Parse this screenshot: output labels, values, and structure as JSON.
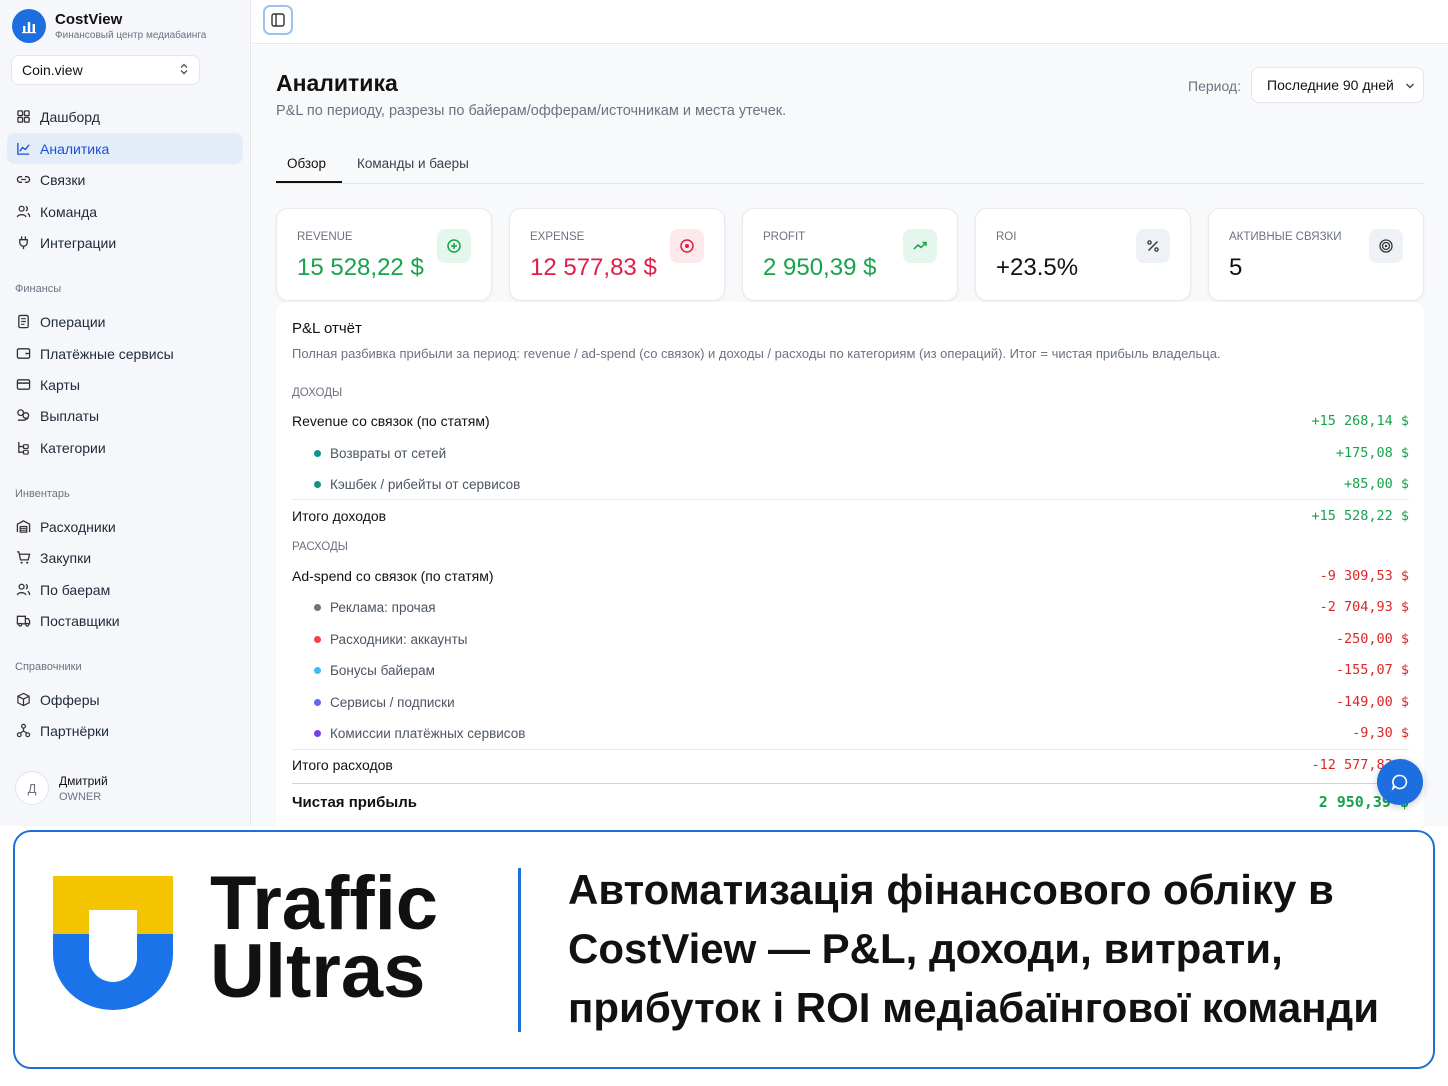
{
  "app": {
    "name": "CostView",
    "subtitle": "Финансовый центр медиабаинга"
  },
  "workspace": {
    "name": "Coin.view"
  },
  "sidebar": {
    "main_items": [
      {
        "label": "Дашборд",
        "icon": "grid-icon"
      },
      {
        "label": "Аналитика",
        "icon": "chart-line-icon",
        "active": true
      },
      {
        "label": "Связки",
        "icon": "link-icon"
      },
      {
        "label": "Команда",
        "icon": "users-icon"
      },
      {
        "label": "Интеграции",
        "icon": "plug-icon"
      }
    ],
    "finance_label": "Финансы",
    "finance_items": [
      {
        "label": "Операции",
        "icon": "receipt-icon"
      },
      {
        "label": "Платёжные сервисы",
        "icon": "wallet-icon"
      },
      {
        "label": "Карты",
        "icon": "credit-card-icon"
      },
      {
        "label": "Выплаты",
        "icon": "hand-coins-icon"
      },
      {
        "label": "Категории",
        "icon": "tree-icon"
      }
    ],
    "inventory_label": "Инвентарь",
    "inventory_items": [
      {
        "label": "Расходники",
        "icon": "warehouse-icon"
      },
      {
        "label": "Закупки",
        "icon": "cart-icon"
      },
      {
        "label": "По баерам",
        "icon": "user-group-icon"
      },
      {
        "label": "Поставщики",
        "icon": "truck-icon"
      }
    ],
    "reference_label": "Справочники",
    "reference_items": [
      {
        "label": "Офферы",
        "icon": "box-icon"
      },
      {
        "label": "Партнёрки",
        "icon": "network-icon"
      }
    ]
  },
  "user": {
    "initial": "Д",
    "name": "Дмитрий",
    "role": "OWNER"
  },
  "page": {
    "title": "Аналитика",
    "subtitle": "P&L по периоду, разрезы по байерам/офферам/источникам и места утечек.",
    "period_label": "Период:",
    "period_value": "Последние 90 дней"
  },
  "tabs": [
    {
      "label": "Обзор",
      "active": true
    },
    {
      "label": "Команды и баеры"
    }
  ],
  "kpis": [
    {
      "label": "REVENUE",
      "value": "15 528,22 $",
      "icon": "plus-circle-icon",
      "color": "#16a34a"
    },
    {
      "label": "EXPENSE",
      "value": "12 577,83 $",
      "icon": "minus-circle-icon",
      "color": "#e11d48"
    },
    {
      "label": "PROFIT",
      "value": "2 950,39 $",
      "icon": "trending-up-icon",
      "color": "#16a34a"
    },
    {
      "label": "ROI",
      "value": "+23.5%",
      "icon": "percent-icon",
      "color": "#111111"
    },
    {
      "label": "АКТИВНЫЕ СВЯЗКИ",
      "value": "5",
      "icon": "target-icon",
      "color": "#111111"
    }
  ],
  "pl": {
    "title": "P&L отчёт",
    "description": "Полная разбивка прибыли за период: revenue / ad-spend (со связок) и доходы / расходы по категориям (из операций). Итог = чистая прибыль владельца.",
    "income_label": "ДОХОДЫ",
    "income_main": {
      "label": "Revenue со связок (по статям)",
      "amount": "+15 268,14 $"
    },
    "income_items": [
      {
        "label": "Возвраты от сетей",
        "amount": "+175,08 $",
        "color": "#0d9488"
      },
      {
        "label": "Кэшбек / рибейты от сервисов",
        "amount": "+85,00 $",
        "color": "#0d9488"
      }
    ],
    "income_total": {
      "label": "Итого доходов",
      "amount": "+15 528,22 $"
    },
    "expense_label": "РАСХОДЫ",
    "expense_main": {
      "label": "Ad-spend со связок (по статям)",
      "amount": "-9 309,53 $"
    },
    "expense_items": [
      {
        "label": "Реклама: прочая",
        "amount": "-2 704,93 $",
        "color": "#6b7280"
      },
      {
        "label": "Расходники: аккаунты",
        "amount": "-250,00 $",
        "color": "#ef4444"
      },
      {
        "label": "Бонусы байерам",
        "amount": "-155,07 $",
        "color": "#38bdf8"
      },
      {
        "label": "Сервисы / подписки",
        "amount": "-149,00 $",
        "color": "#6366f1"
      },
      {
        "label": "Комиссии платёжных сервисов",
        "amount": "-9,30 $",
        "color": "#7c3aed"
      }
    ],
    "expense_total": {
      "label": "Итого расходов",
      "amount": "-12 577,83 $"
    },
    "net": {
      "label": "Чистая прибыль",
      "amount": "2 950,39 $"
    }
  },
  "banner": {
    "brand_line1": "Traffic",
    "brand_line2": "Ultras",
    "headline": "Автоматизація фінансового обліку в CostView — P&L, доходи, витрати, прибуток і ROI медіабаїнгової команди",
    "colors": {
      "yellow": "#f5c400",
      "blue": "#1a73e8",
      "border": "#1f6fd8"
    }
  }
}
